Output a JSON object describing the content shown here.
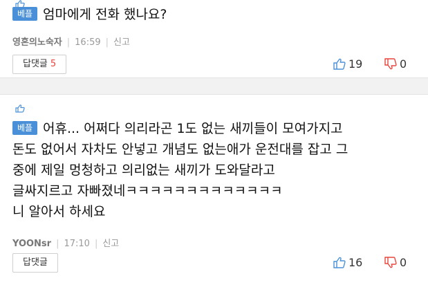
{
  "comments": [
    {
      "badge": "베플",
      "text": "엄마에게 전화 했나요?",
      "author": "영혼의노숙자",
      "time": "16:59",
      "report_label": "신고",
      "reply_label": "답댓글",
      "reply_count": "5",
      "likes": "19",
      "dislikes": "0"
    },
    {
      "badge": "베플",
      "text_first_line": "어휴... 어쩌다 의리라곤 1도 없는 새끼들이 모여가지고",
      "text_rest": "돈도 없어서 자차도 안넣고 개념도 없는애가 운전대를 잡고 그\n중에 제일 멍청하고 의리없는 새끼가 도와달라고\n글싸지르고 자빠졌네ㅋㅋㅋㅋㅋㅋㅋㅋㅋㅋㅋㅋㅋ\n니 알아서 하세요",
      "author": "YOONsr",
      "time": "17:10",
      "report_label": "신고",
      "reply_label": "답댓글",
      "likes": "16",
      "dislikes": "0"
    }
  ],
  "colors": {
    "badge": "#4a90d9",
    "like": "#4a90d9",
    "dislike": "#e8453c",
    "reply_count": "#e8453c"
  },
  "icons": {
    "best": "thumbs-up-outline",
    "like": "thumbs-up-outline",
    "dislike": "thumbs-down-outline"
  }
}
